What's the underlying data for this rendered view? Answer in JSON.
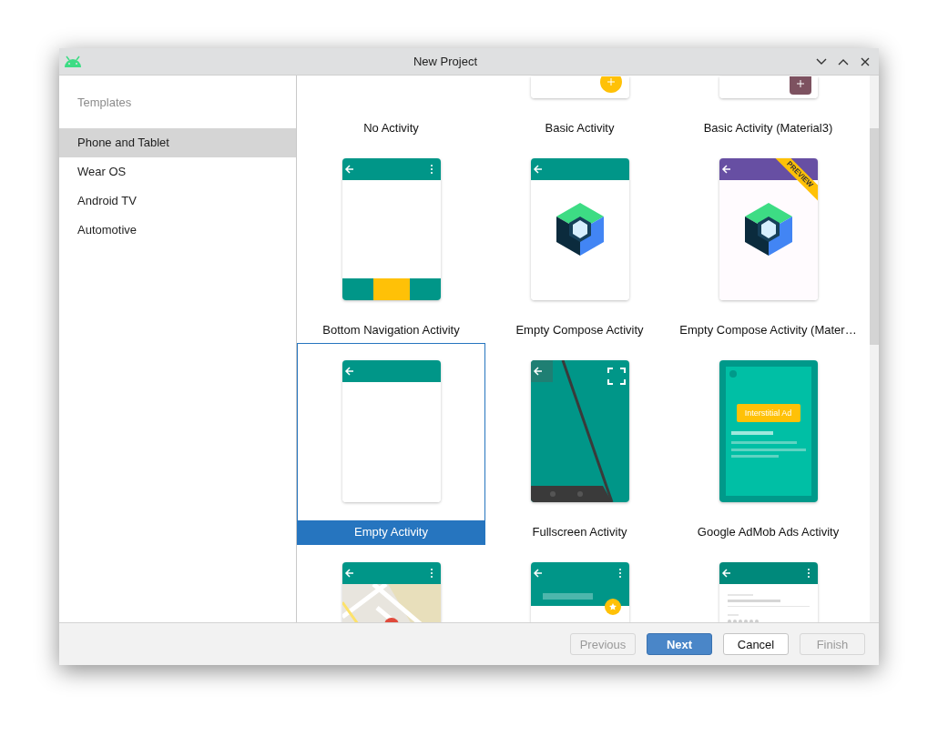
{
  "window": {
    "title": "New Project"
  },
  "sidebar": {
    "heading": "Templates",
    "items": [
      {
        "label": "Phone and Tablet",
        "selected": true
      },
      {
        "label": "Wear OS",
        "selected": false
      },
      {
        "label": "Android TV",
        "selected": false
      },
      {
        "label": "Automotive",
        "selected": false
      }
    ]
  },
  "templates": [
    {
      "label": "No Activity",
      "selected": false,
      "kind": "blank"
    },
    {
      "label": "Basic Activity",
      "selected": false,
      "kind": "basic"
    },
    {
      "label": "Basic Activity (Material3)",
      "selected": false,
      "kind": "basic-m3"
    },
    {
      "label": "Bottom Navigation Activity",
      "selected": false,
      "kind": "bottom-nav"
    },
    {
      "label": "Empty Compose Activity",
      "selected": false,
      "kind": "compose"
    },
    {
      "label": "Empty Compose Activity (Mater…",
      "selected": false,
      "kind": "compose-m3",
      "badge": "PREVIEW"
    },
    {
      "label": "Empty Activity",
      "selected": true,
      "kind": "empty"
    },
    {
      "label": "Fullscreen Activity",
      "selected": false,
      "kind": "fullscreen"
    },
    {
      "label": "Google AdMob Ads Activity",
      "selected": false,
      "kind": "admob",
      "ad_label": "Interstitial Ad"
    },
    {
      "selected": false,
      "kind": "maps"
    },
    {
      "selected": false,
      "kind": "scrolling"
    },
    {
      "selected": false,
      "kind": "list"
    }
  ],
  "buttons": [
    {
      "label": "Previous",
      "disabled": true,
      "default": false
    },
    {
      "label": "Next",
      "disabled": false,
      "default": true
    },
    {
      "label": "Cancel",
      "disabled": false,
      "default": false
    },
    {
      "label": "Finish",
      "disabled": true,
      "default": false
    }
  ]
}
